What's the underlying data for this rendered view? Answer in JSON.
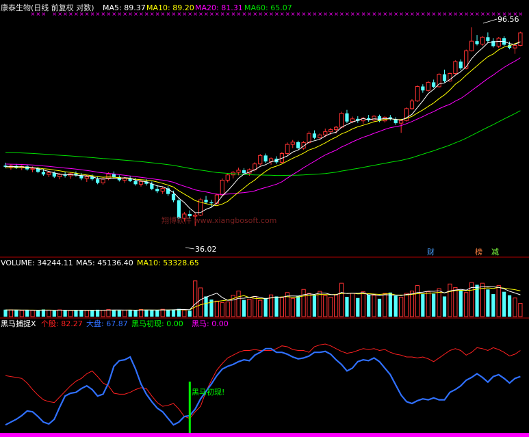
{
  "header": {
    "stock_title": "康泰生物(日线 前复权 对数)",
    "ma5_label": "MA5: 89.37",
    "ma10_label": "MA10: 89.20",
    "ma20_label": "MA20: 81.31",
    "ma60_label": "MA60: 65.07"
  },
  "price_panel": {
    "high_label": "96.56",
    "low_label": "36.02",
    "watermark": "翔博软件 www.xiangbosoft.com",
    "markers": [
      "财",
      "榜",
      "减"
    ]
  },
  "volume_panel": {
    "volume_label": "VOLUME: 34244.11",
    "ma5_label": "MA5: 45136.40",
    "ma10_label": "MA10: 53328.65"
  },
  "indicator_panel": {
    "name": "黑马捕捉X",
    "stock_label": "个股: 82.27",
    "market_label": "大盘: 67.87",
    "first_label": "黑马初现: 0.00",
    "horse_label": "黑马: 0.00",
    "signal_text": "黑马初现!"
  },
  "colors": {
    "up": "#ff3232",
    "down": "#54ffff",
    "ma5": "#ffffff",
    "ma10": "#ffff00",
    "ma20": "#ff00ff",
    "ma60": "#00e000",
    "stock_line": "#ff2020",
    "market_line": "#3070ff",
    "signal": "#00ff00",
    "x_marker": "#ff00ff"
  },
  "chart_data": [
    {
      "type": "candlestick",
      "y_scale": "log",
      "ylim": [
        33,
        102
      ],
      "n": 96,
      "candles": [
        [
          48.6,
          49.3,
          48.0,
          48.3
        ],
        [
          48.3,
          48.9,
          47.6,
          48.5
        ],
        [
          48.5,
          49.0,
          47.8,
          48.1
        ],
        [
          48.1,
          48.7,
          47.5,
          48.4
        ],
        [
          48.4,
          48.8,
          47.4,
          47.7
        ],
        [
          47.7,
          48.4,
          47.0,
          47.9
        ],
        [
          47.9,
          48.3,
          46.8,
          47.1
        ],
        [
          47.1,
          47.8,
          46.2,
          46.5
        ],
        [
          46.5,
          47.3,
          45.9,
          46.9
        ],
        [
          46.9,
          47.2,
          45.7,
          46.0
        ],
        [
          46.0,
          46.8,
          45.4,
          46.5
        ],
        [
          46.5,
          47.1,
          45.8,
          46.2
        ],
        [
          46.2,
          46.9,
          45.5,
          46.7
        ],
        [
          46.7,
          47.2,
          46.0,
          46.3
        ],
        [
          46.3,
          46.8,
          45.2,
          45.6
        ],
        [
          45.6,
          46.4,
          44.8,
          46.0
        ],
        [
          46.0,
          46.5,
          45.1,
          45.4
        ],
        [
          45.4,
          46.1,
          44.3,
          44.6
        ],
        [
          44.6,
          45.8,
          44.2,
          45.5
        ],
        [
          45.5,
          47.0,
          45.2,
          46.6
        ],
        [
          46.6,
          47.2,
          45.6,
          45.9
        ],
        [
          45.9,
          46.3,
          44.9,
          45.2
        ],
        [
          45.2,
          45.9,
          44.6,
          45.6
        ],
        [
          45.6,
          46.1,
          44.8,
          45.0
        ],
        [
          45.0,
          45.7,
          44.0,
          44.3
        ],
        [
          44.3,
          45.2,
          43.8,
          44.9
        ],
        [
          44.9,
          45.4,
          44.0,
          44.4
        ],
        [
          44.4,
          44.9,
          43.0,
          43.3
        ],
        [
          43.3,
          44.1,
          42.4,
          42.8
        ],
        [
          42.8,
          43.7,
          42.2,
          43.4
        ],
        [
          43.4,
          43.9,
          41.8,
          42.2
        ],
        [
          42.2,
          42.9,
          40.5,
          40.9
        ],
        [
          40.9,
          41.5,
          36.5,
          37.4
        ],
        [
          37.4,
          38.6,
          36.8,
          38.2
        ],
        [
          38.2,
          38.9,
          37.3,
          37.8
        ],
        [
          37.8,
          38.4,
          36.0,
          38.0
        ],
        [
          38.0,
          41.4,
          37.8,
          41.0
        ],
        [
          41.0,
          41.8,
          40.2,
          40.5
        ],
        [
          40.5,
          41.0,
          39.6,
          40.3
        ],
        [
          40.3,
          42.3,
          40.0,
          42.0
        ],
        [
          42.0,
          45.6,
          41.8,
          45.2
        ],
        [
          45.2,
          46.8,
          44.7,
          46.4
        ],
        [
          46.4,
          47.3,
          45.6,
          47.0
        ],
        [
          47.0,
          48.1,
          46.3,
          47.5
        ],
        [
          47.5,
          48.0,
          46.4,
          46.8
        ],
        [
          46.8,
          47.9,
          46.2,
          47.6
        ],
        [
          47.6,
          49.4,
          47.2,
          49.0
        ],
        [
          49.0,
          51.5,
          48.6,
          51.1
        ],
        [
          51.1,
          51.6,
          49.2,
          49.6
        ],
        [
          49.6,
          50.6,
          48.8,
          50.3
        ],
        [
          50.3,
          50.9,
          49.0,
          49.4
        ],
        [
          49.4,
          52.0,
          49.1,
          51.6
        ],
        [
          51.6,
          54.5,
          51.2,
          54.0
        ],
        [
          54.0,
          55.2,
          53.0,
          54.6
        ],
        [
          54.6,
          55.0,
          52.7,
          53.0
        ],
        [
          53.0,
          54.9,
          52.6,
          54.5
        ],
        [
          54.5,
          57.6,
          54.1,
          57.0
        ],
        [
          57.0,
          57.9,
          55.4,
          55.8
        ],
        [
          55.8,
          57.0,
          55.2,
          56.6
        ],
        [
          56.6,
          58.4,
          56.0,
          57.5
        ],
        [
          57.5,
          58.6,
          56.6,
          58.1
        ],
        [
          58.1,
          59.2,
          57.0,
          58.8
        ],
        [
          58.8,
          63.5,
          58.5,
          63.0
        ],
        [
          63.0,
          64.1,
          60.0,
          60.5
        ],
        [
          60.5,
          62.0,
          60.0,
          61.3
        ],
        [
          61.3,
          62.1,
          60.1,
          60.7
        ],
        [
          60.7,
          61.9,
          59.7,
          61.5
        ],
        [
          61.5,
          62.5,
          60.4,
          60.9
        ],
        [
          60.9,
          62.5,
          60.5,
          62.1
        ],
        [
          62.1,
          62.6,
          60.3,
          60.7
        ],
        [
          60.7,
          62.1,
          60.2,
          61.8
        ],
        [
          61.8,
          62.5,
          60.8,
          61.2
        ],
        [
          61.2,
          61.8,
          59.5,
          60.0
        ],
        [
          60.0,
          61.2,
          57.2,
          60.8
        ],
        [
          60.8,
          64.9,
          60.5,
          64.5
        ],
        [
          64.5,
          67.6,
          64.2,
          67.0
        ],
        [
          67.0,
          72.4,
          66.7,
          72.0
        ],
        [
          72.0,
          72.8,
          69.8,
          70.6
        ],
        [
          70.6,
          74.0,
          70.1,
          73.5
        ],
        [
          73.5,
          74.5,
          71.4,
          71.9
        ],
        [
          71.9,
          77.0,
          71.6,
          76.5
        ],
        [
          76.5,
          78.3,
          73.5,
          74.0
        ],
        [
          74.0,
          77.2,
          73.6,
          76.8
        ],
        [
          76.8,
          82.0,
          76.4,
          81.5
        ],
        [
          81.5,
          82.4,
          78.2,
          78.8
        ],
        [
          78.8,
          86.5,
          78.4,
          86.0
        ],
        [
          86.0,
          96.6,
          85.7,
          90.2
        ],
        [
          90.2,
          93.0,
          88.3,
          88.9
        ],
        [
          88.9,
          92.5,
          88.2,
          92.0
        ],
        [
          92.0,
          94.2,
          89.5,
          90.3
        ],
        [
          90.3,
          91.5,
          87.4,
          88.0
        ],
        [
          88.0,
          92.1,
          87.2,
          91.5
        ],
        [
          91.5,
          92.4,
          88.1,
          88.6
        ],
        [
          88.6,
          90.0,
          86.6,
          87.2
        ],
        [
          87.2,
          89.2,
          84.7,
          88.3
        ],
        [
          88.3,
          94.5,
          88.0,
          94.0
        ]
      ],
      "ma5_last": 89.37,
      "ma10_last": 89.2,
      "ma20_last": 81.31,
      "ma60_last": 65.07,
      "annotations": [
        "96.56",
        "36.02"
      ]
    },
    {
      "type": "bar",
      "series": "volume",
      "ylim": [
        0,
        125000
      ],
      "values": [
        18000,
        17500,
        16500,
        15800,
        17000,
        16200,
        15500,
        18500,
        16800,
        15200,
        17500,
        16000,
        15800,
        16600,
        17400,
        15900,
        16200,
        17800,
        16500,
        18200,
        17000,
        15600,
        16800,
        17300,
        16100,
        18500,
        17200,
        15900,
        16600,
        19000,
        17800,
        18600,
        20000,
        16800,
        15500,
        92000,
        74000,
        52000,
        44000,
        40000,
        36000,
        38000,
        55000,
        66000,
        43000,
        45000,
        52000,
        42000,
        48000,
        56000,
        52000,
        49000,
        62000,
        47000,
        54000,
        70000,
        60000,
        55000,
        65000,
        54000,
        50000,
        56000,
        86000,
        51000,
        60000,
        48000,
        64000,
        57000,
        55000,
        46000,
        60000,
        62000,
        54000,
        50000,
        60000,
        66000,
        80000,
        58000,
        64000,
        59000,
        72000,
        52000,
        84000,
        75000,
        68000,
        62000,
        88000,
        82000,
        86000,
        70000,
        58000,
        80000,
        64000,
        55000,
        48000,
        34244
      ],
      "ma5_last": 45136.4,
      "ma10_last": 53328.65
    },
    {
      "type": "line",
      "ylim": [
        0,
        100
      ],
      "series": [
        {
          "name": "个股",
          "values": [
            55,
            54,
            53,
            52,
            47,
            40,
            34,
            29,
            27,
            26,
            32,
            38,
            44,
            49,
            52,
            57,
            60,
            54,
            47,
            44,
            36,
            35,
            35,
            37,
            40,
            42,
            41,
            33,
            26,
            22,
            23,
            25,
            19,
            11,
            9,
            16,
            22,
            38,
            50,
            61,
            68,
            74,
            77,
            80,
            82,
            82,
            83,
            82,
            82,
            82,
            84,
            87,
            86,
            83,
            82,
            82,
            80,
            86,
            88,
            89,
            87,
            84,
            81,
            79,
            80,
            82,
            84,
            83,
            84,
            82,
            83,
            80,
            78,
            77,
            75,
            75,
            74,
            75,
            73,
            70,
            74,
            78,
            82,
            84,
            82,
            77,
            80,
            85,
            84,
            82,
            85,
            83,
            80,
            76,
            78,
            82
          ]
        },
        {
          "name": "大盘",
          "values": [
            2,
            5,
            8,
            12,
            17,
            16,
            11,
            5,
            3,
            8,
            21,
            33,
            36,
            37,
            41,
            44,
            40,
            33,
            35,
            47,
            65,
            71,
            72,
            75,
            62,
            46,
            35,
            27,
            20,
            16,
            9,
            2,
            5,
            11,
            12,
            19,
            30,
            38,
            46,
            55,
            62,
            65,
            67,
            70,
            72,
            71,
            77,
            80,
            84,
            84,
            80,
            80,
            78,
            75,
            73,
            74,
            76,
            80,
            80,
            81,
            78,
            72,
            67,
            60,
            63,
            70,
            72,
            71,
            74,
            70,
            63,
            56,
            45,
            34,
            27,
            25,
            28,
            30,
            29,
            31,
            29,
            29,
            37,
            40,
            44,
            50,
            53,
            57,
            53,
            48,
            54,
            56,
            52,
            47,
            52,
            54
          ]
        }
      ],
      "signal_index": 34
    }
  ]
}
